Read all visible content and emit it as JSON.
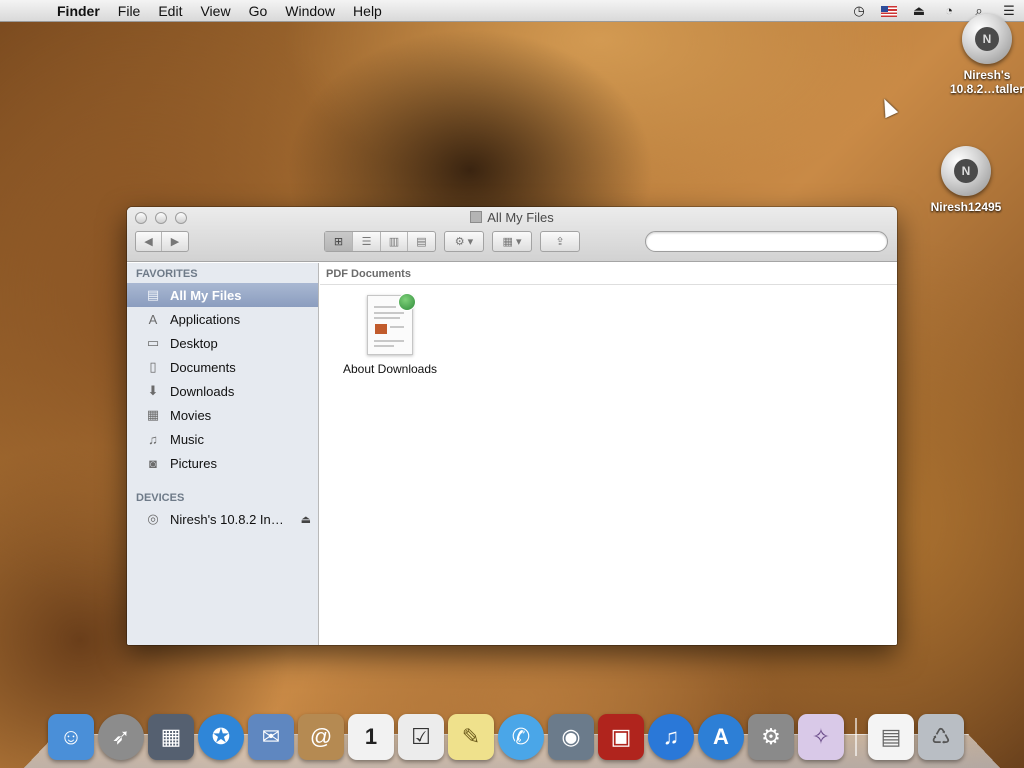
{
  "menubar": {
    "apple_glyph": "",
    "app_name": "Finder",
    "menus": [
      "File",
      "Edit",
      "View",
      "Go",
      "Window",
      "Help"
    ],
    "status_icons": [
      "time-machine-icon",
      "us-flag-icon",
      "eject-icon",
      "clock-icon",
      "spotlight-icon",
      "notification-list-icon"
    ]
  },
  "desktop": {
    "icons": [
      {
        "name_line1": "Niresh's",
        "name_line2": "10.8.2…taller",
        "icon": "install-disk-icon",
        "badge": "N"
      },
      {
        "name": "Niresh12495",
        "icon": "hard-disk-icon",
        "badge": "N"
      }
    ]
  },
  "window": {
    "title": "All My Files",
    "view_buttons": [
      "icon-view",
      "list-view",
      "column-view",
      "cover-flow-view"
    ],
    "search": {
      "value": "",
      "placeholder": ""
    },
    "sidebar": {
      "favorites_header": "FAVORITES",
      "favorites": [
        {
          "label": "All My Files",
          "icon": "all-my-files-icon",
          "glyph": "▤"
        },
        {
          "label": "Applications",
          "icon": "applications-icon",
          "glyph": "A"
        },
        {
          "label": "Desktop",
          "icon": "desktop-icon",
          "glyph": "▭"
        },
        {
          "label": "Documents",
          "icon": "documents-icon",
          "glyph": "▯"
        },
        {
          "label": "Downloads",
          "icon": "downloads-icon",
          "glyph": "⬇"
        },
        {
          "label": "Movies",
          "icon": "movies-icon",
          "glyph": "▦"
        },
        {
          "label": "Music",
          "icon": "music-icon",
          "glyph": "♫"
        },
        {
          "label": "Pictures",
          "icon": "pictures-icon",
          "glyph": "◙"
        }
      ],
      "devices_header": "DEVICES",
      "devices": [
        {
          "label": "Niresh's 10.8.2 In…",
          "icon": "cd-disk-icon"
        }
      ]
    },
    "content": {
      "group_header": "PDF Documents",
      "files": [
        {
          "label": "About Downloads",
          "icon": "pdf-document-icon"
        }
      ]
    }
  },
  "dock": {
    "apps": [
      {
        "icon": "finder-icon",
        "color": "#4a8fd8",
        "glyph": "☺"
      },
      {
        "icon": "launchpad-icon",
        "color": "#8c8c8c",
        "glyph": "➶"
      },
      {
        "icon": "mission-control-icon",
        "color": "#556070",
        "glyph": "▦"
      },
      {
        "icon": "safari-icon",
        "color": "#2f86d8",
        "glyph": "✪"
      },
      {
        "icon": "mail-icon",
        "color": "#5f87c0",
        "glyph": "✉"
      },
      {
        "icon": "contacts-icon",
        "color": "#b58a52",
        "glyph": "@"
      },
      {
        "icon": "calendar-icon",
        "color": "#f2f2f2",
        "glyph": "1"
      },
      {
        "icon": "reminders-icon",
        "color": "#ececec",
        "glyph": "☑"
      },
      {
        "icon": "notes-icon",
        "color": "#efe18c",
        "glyph": "✎"
      },
      {
        "icon": "messages-icon",
        "color": "#4aa6e8",
        "glyph": "✆"
      },
      {
        "icon": "facetime-icon",
        "color": "#6b7b8b",
        "glyph": "◉"
      },
      {
        "icon": "photo-booth-icon",
        "color": "#b0241d",
        "glyph": "▣"
      },
      {
        "icon": "itunes-icon",
        "color": "#2a78d8",
        "glyph": "♫"
      },
      {
        "icon": "app-store-icon",
        "color": "#2d7fd6",
        "glyph": "A"
      },
      {
        "icon": "system-preferences-icon",
        "color": "#8a8a8a",
        "glyph": "⚙"
      },
      {
        "icon": "installer-wizard-icon",
        "color": "#d9c9e8",
        "glyph": "✧"
      }
    ],
    "others": [
      {
        "icon": "document-stack-icon",
        "color": "#f4f4f4",
        "glyph": "▤"
      },
      {
        "icon": "trash-icon",
        "color": "#b9bec4",
        "glyph": "♺"
      }
    ]
  }
}
